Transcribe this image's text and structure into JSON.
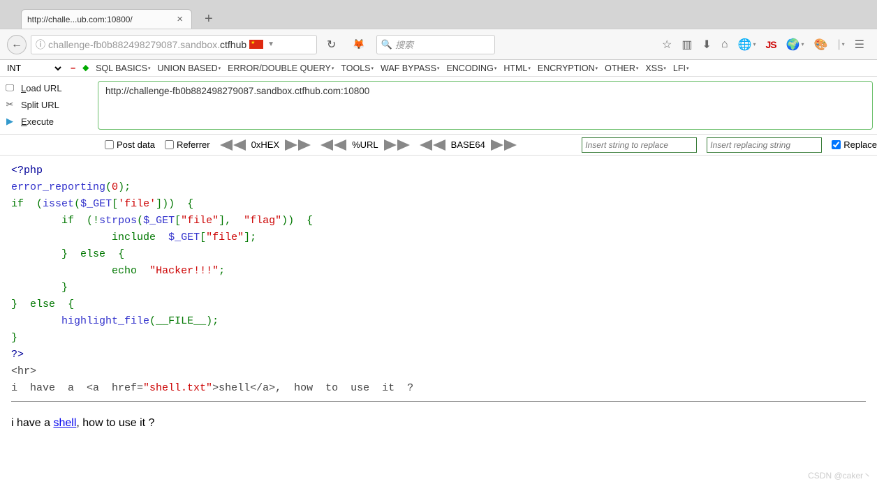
{
  "tab": {
    "title": "http://challe...ub.com:10800/"
  },
  "url": {
    "prefix": "challenge-fb0b882498279087.sandbox.",
    "domain": "ctfhub",
    "full": "http://challenge-fb0b882498279087.sandbox.ctfhub.com:10800"
  },
  "search": {
    "placeholder": "搜索"
  },
  "hackbar": {
    "selector": "INT",
    "menu": [
      "SQL BASICS",
      "UNION BASED",
      "ERROR/DOUBLE QUERY",
      "TOOLS",
      "WAF BYPASS",
      "ENCODING",
      "HTML",
      "ENCRYPTION",
      "OTHER",
      "XSS",
      "LFI"
    ],
    "actions": {
      "load": "oad URL",
      "load_u": "L",
      "split": "Split URL",
      "execute": "xecute",
      "execute_u": "E"
    },
    "controls": {
      "post": "Post data",
      "referrer": "Referrer",
      "enc1": "0xHEX",
      "enc2": "%URL",
      "enc3": "BASE64",
      "replace_find_ph": "Insert string to replace",
      "replace_with_ph": "Insert replacing string",
      "replace_label": "Replace"
    }
  },
  "code": {
    "l1_open": "<?php",
    "l2_fn": "error_reporting",
    "l2_arg": "0",
    "l3_if": "if",
    "l3_isset": "isset",
    "l3_get": "$_GET",
    "l3_key": "'file'",
    "l4_if": "if",
    "l4_strpos": "strpos",
    "l4_get": "$_GET",
    "l4_k1": "\"file\"",
    "l4_k2": "\"flag\"",
    "l5_inc": "include",
    "l5_get": "$_GET",
    "l5_k": "\"file\"",
    "l6_else": "else",
    "l7_echo": "echo",
    "l7_str": "\"Hacker!!!\"",
    "l8_else": "else",
    "l9_hl": "highlight_file",
    "l9_file": "__FILE__",
    "l10_close": "?>",
    "l11_hr": "<hr>",
    "l12_pre": "i  have  a  <a  href=",
    "l12_href": "\"shell.txt\"",
    "l12_mid": ">shell</a>,  how  to  use  it  ?"
  },
  "hint": {
    "pre": "i have a ",
    "link": "shell",
    "post": ", how to use it ?"
  },
  "watermark": "CSDN @caker丶"
}
